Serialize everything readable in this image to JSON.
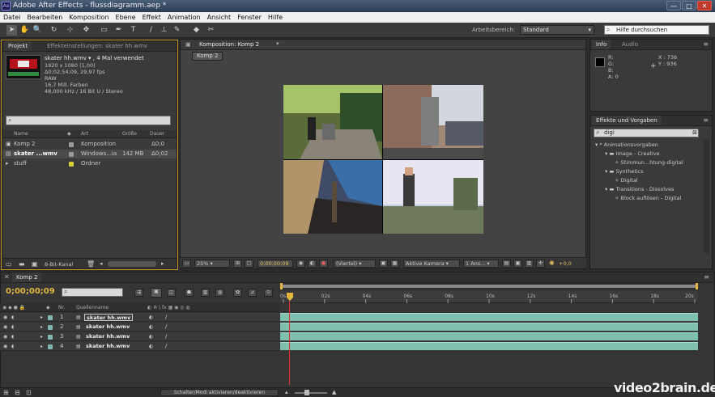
{
  "window": {
    "app_icon": "Ae",
    "title": "Adobe After Effects - flussdiagramm.aep *",
    "minimize": "—",
    "maximize": "□",
    "close": "✕"
  },
  "menu": [
    "Datei",
    "Bearbeiten",
    "Komposition",
    "Ebene",
    "Effekt",
    "Animation",
    "Ansicht",
    "Fenster",
    "Hilfe"
  ],
  "toolbar": {
    "tools": [
      "➤",
      "✋",
      "🔍",
      "↻",
      "⊹",
      "✥",
      "▭",
      "✒",
      "T",
      "/",
      "⊥",
      "✎",
      "◆",
      "✂"
    ],
    "workspace_label": "Arbeitsbereich:",
    "workspace_value": "Standard",
    "help_placeholder": "Hilfe durchsuchen"
  },
  "project": {
    "tab_project": "Projekt",
    "tab_effects": "Effekteinstellungen: skater hh.wmv",
    "info_name": "skater hh.wmv ▾ , 4 Mal verwendet",
    "info_lines": [
      "1920 x 1080 (1,00)",
      "Δ0;02;54;09, 29,97 fps",
      "RAW",
      "16,7 Mill. Farben",
      "48,000 kHz / 16 Bit U / Stereo"
    ],
    "search_value": "",
    "columns": [
      "Name",
      "Art",
      "Größe",
      "Dauer"
    ],
    "items": [
      {
        "name": "Komp 2",
        "type": "Komposition",
        "size": "",
        "duration": "Δ0;0",
        "color": "#9a9a9a",
        "icon": "▣"
      },
      {
        "name": "skater ...wmv",
        "type": "Windows...ia",
        "size": "142 MB",
        "duration": "Δ0;02",
        "color": "#9a9a9a",
        "icon": "▤"
      },
      {
        "name": "stuff",
        "type": "Ordner",
        "size": "",
        "duration": "",
        "color": "#d4d23c",
        "icon": "▸"
      }
    ],
    "bit_depth": "8-Bit-Kanal"
  },
  "comp": {
    "tab": "Komposition: Komp 2",
    "breadcrumb": "Komp 2",
    "zoom": "25%",
    "timecode": "0;00;00;09",
    "resolution": "(Viertel)",
    "camera": "Aktive Kamera",
    "views": "1 Ans...",
    "exposure": "+0,0"
  },
  "info_panel": {
    "tab_info": "Info",
    "tab_audio": "Audio",
    "r": "R:",
    "g": "G:",
    "b": "B:",
    "a": "A:  0",
    "x": "X : 736",
    "y": "Y : 936"
  },
  "effects": {
    "tab": "Effekte und Vorgaben",
    "search_value": "digi",
    "tree": [
      {
        "label": "* Animationsvorgaben",
        "level": 0
      },
      {
        "label": "Image - Creative",
        "level": 1
      },
      {
        "label": "Stimmun...htung-digital",
        "level": 2
      },
      {
        "label": "Synthetics",
        "level": 1
      },
      {
        "label": "Digital",
        "level": 2
      },
      {
        "label": "Transitions - Dissolves",
        "level": 1
      },
      {
        "label": "Block auflösen - Digital",
        "level": 2
      }
    ]
  },
  "timeline": {
    "tab": "Komp 2",
    "timecode": "0;00;00;09",
    "search_value": "",
    "header_src": "Quellenname",
    "header_nr": "Nr.",
    "ruler": [
      "0s",
      "02s",
      "04s",
      "06s",
      "08s",
      "10s",
      "12s",
      "14s",
      "16s",
      "18s",
      "20s"
    ],
    "layers": [
      {
        "nr": "1",
        "name": "skater hh.wmv"
      },
      {
        "nr": "2",
        "name": "skater hh.wmv"
      },
      {
        "nr": "3",
        "name": "skater hh.wmv"
      },
      {
        "nr": "4",
        "name": "skater hh.wmv"
      }
    ],
    "mode_toggle": "Schalter/Modi aktivieren/deaktivieren"
  },
  "watermark": "video2brain.de"
}
